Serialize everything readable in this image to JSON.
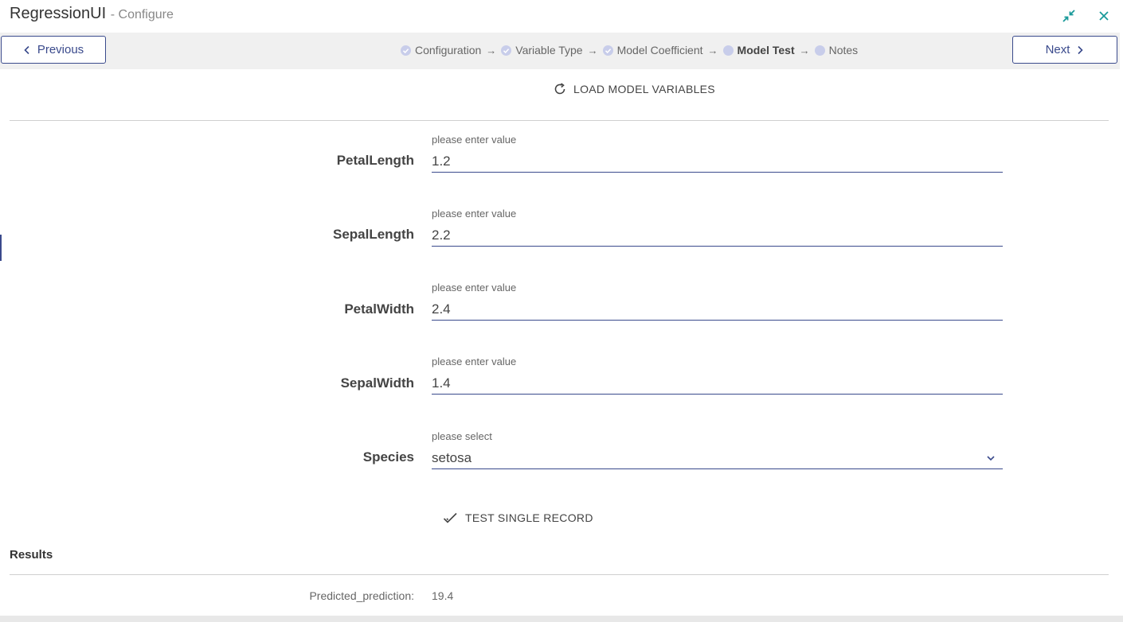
{
  "window": {
    "title": "RegressionUI",
    "subtitle": "- Configure",
    "minimize_icon": "collapse-arrows-icon",
    "close_icon": "close-icon",
    "accent_color": "#3a4a8c",
    "window_icon_color": "#1a9a9a"
  },
  "wizard": {
    "previous_label": "Previous",
    "next_label": "Next",
    "steps": [
      {
        "label": "Configuration",
        "state": "done"
      },
      {
        "label": "Variable Type",
        "state": "done"
      },
      {
        "label": "Model Coefficient",
        "state": "done"
      },
      {
        "label": "Model Test",
        "state": "active"
      },
      {
        "label": "Notes",
        "state": "pending"
      }
    ],
    "arrow": "→"
  },
  "toolbar": {
    "load_label": "LOAD MODEL VARIABLES",
    "test_label": "TEST SINGLE RECORD"
  },
  "fields": [
    {
      "label": "PetalLength",
      "hint": "please enter value",
      "value": "1.2"
    },
    {
      "label": "SepalLength",
      "hint": "please enter value",
      "value": "2.2"
    },
    {
      "label": "PetalWidth",
      "hint": "please enter value",
      "value": "2.4"
    },
    {
      "label": "SepalWidth",
      "hint": "please enter value",
      "value": "1.4"
    }
  ],
  "species": {
    "label": "Species",
    "hint": "please select",
    "value": "setosa"
  },
  "results": {
    "title": "Results",
    "label": "Predicted_prediction:",
    "value": "19.4"
  }
}
